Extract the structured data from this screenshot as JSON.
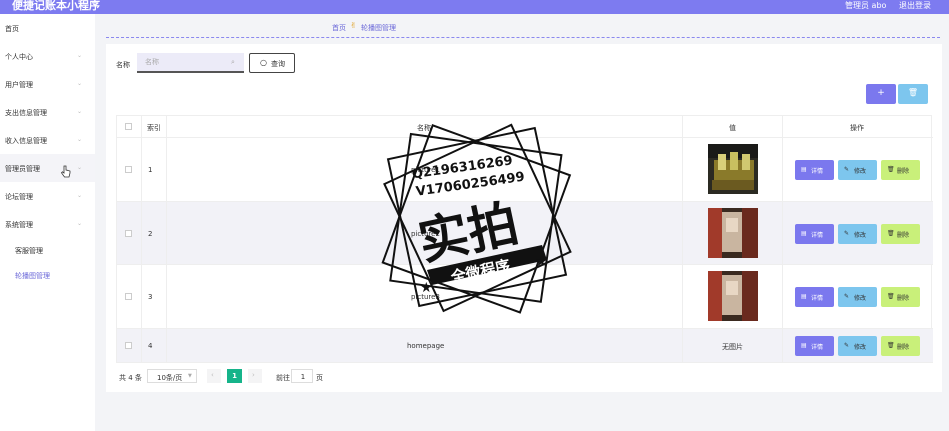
{
  "header": {
    "title": "便捷记账本小程序",
    "admin": "管理员 abo",
    "logout": "退出登录"
  },
  "sidebar": {
    "items": [
      {
        "label": "首页",
        "chevron": false
      },
      {
        "label": "个人中心",
        "chevron": true
      },
      {
        "label": "用户管理",
        "chevron": true
      },
      {
        "label": "支出信息管理",
        "chevron": true
      },
      {
        "label": "收入信息管理",
        "chevron": true
      },
      {
        "label": "管理员管理",
        "chevron": true
      },
      {
        "label": "论坛管理",
        "chevron": true
      },
      {
        "label": "系统管理",
        "chevron": true
      }
    ],
    "chevron_glyph": "⌄",
    "sub_items": [
      {
        "label": "客服管理",
        "active": false
      },
      {
        "label": "轮播图管理",
        "active": true
      }
    ]
  },
  "breadcrumb": {
    "home": "首页",
    "current": "轮播图管理"
  },
  "search": {
    "label": "名称",
    "placeholder": "名称",
    "button": "查询"
  },
  "toolbar": {
    "add": "+",
    "delete": "🗑"
  },
  "table": {
    "headers": [
      "",
      "索引",
      "名称",
      "值",
      "操作"
    ],
    "rows": [
      {
        "index": "1",
        "name": "picture1",
        "value": "",
        "has_image": true
      },
      {
        "index": "2",
        "name": "picture2",
        "value": "",
        "has_image": true
      },
      {
        "index": "3",
        "name": "picture3",
        "value": "",
        "has_image": true
      },
      {
        "index": "4",
        "name": "homepage",
        "value": "无图片",
        "has_image": false
      }
    ],
    "ops": {
      "detail": "详情",
      "edit": "修改",
      "delete": "删除"
    }
  },
  "pager": {
    "total": "共 4 条",
    "size": "10条/页",
    "current": "1",
    "goto": "前往",
    "goto_value": "1",
    "unit": "页",
    "prev": "‹",
    "next": "›"
  },
  "watermark": {
    "line1": "Q2196316269",
    "line2": "V17060256499",
    "big": "实拍",
    "ribbon": "全微程序"
  },
  "colors": {
    "accent": "#7d7bf0",
    "detail": "#7b78ee",
    "edit": "#7dc6ee",
    "delete": "#c9f07a",
    "page": "#16b48a"
  }
}
